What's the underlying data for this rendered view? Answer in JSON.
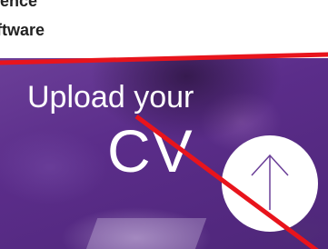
{
  "top_text": {
    "line1": "tence",
    "line2": "ftware"
  },
  "banner": {
    "title": "Upload your",
    "subtitle": "CV",
    "upload_icon": "arrow-up-icon"
  },
  "colors": {
    "banner_purple": "#5b2d8a",
    "annotation_red": "#e8141c",
    "text_dark": "#222222"
  }
}
